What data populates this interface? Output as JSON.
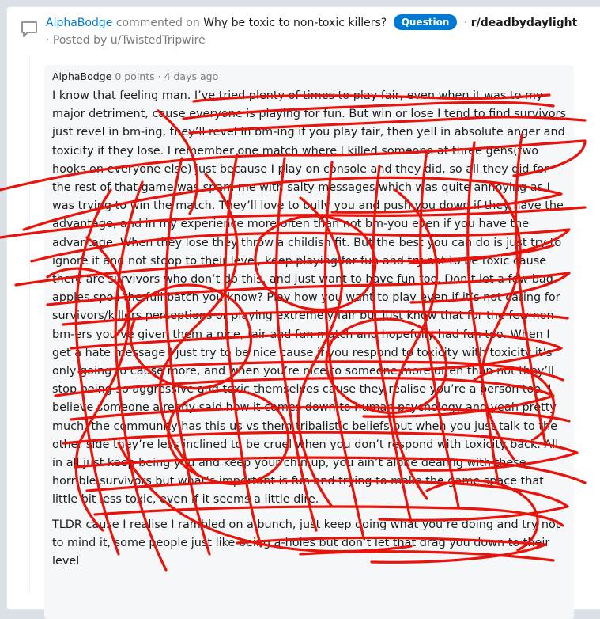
{
  "header": {
    "commenter": "AlphaBodge",
    "action_text": "commented on",
    "post_title": "Why be toxic to non-toxic killers?",
    "flair": "Question",
    "separator": "·",
    "subreddit": "r/deadbydaylight",
    "posted_by_text": "· Posted by",
    "poster": "u/TwistedTripwire"
  },
  "comment": {
    "author": "AlphaBodge",
    "points": "0 points",
    "age": "· 4 days ago",
    "paragraphs": [
      "I know that feeling man. I’ve tried plenty of times to play fair, even when it was to my major detriment, cause everyone is playing for fun. But win or lose I tend to find survivors just revel in bm-ing, they’ll revel in bm-ing if you play fair, then yell in absolute anger and toxicity if they lose. I remember one match where I killed someone at three gens(two hooks on everyone else) just because I play on console and they did, so all they did for the rest of that game was spam me with salty messages which was quite annoying as I was trying to win the match. They’ll love to bully you and push you down if they have the advantage, and in my experience more often than not bm-you even if you have the advantage. When they lose they throw a childish fit. But the best you can do is just try to ignore it and not stoop to their level, keep playing for fun and try not to be toxic cause there are survivors who don’t do this, and just want to have fun too. Don’t let a few bad apples spoil the full batch you know? Play how you want to play even if it’s not caring for survivors/killers perceptions or playing extremely fair but just know that for the few non bm-ers you’ve given them a nice, fair and fun match and hopefully had fun too. When I get a hate message I just try to be nice cause if you respond to toxicity with toxicity it’s only going to cause more, and when you’re nice to someone more often than not they’ll stop being so aggressive and toxic themselves cause they realise you’re a person too. I believe someone already said how it comes down to human psychology and yeah pretty much, the community has this us vs them tribalistic beliefs but when you just talk to the other side they’re less inclined to be cruel when you don’t respond with toxicity back. All in all just keep being you and keep your chin up, you ain’t alone dealing with these horrible survivors but what’s important is fun and trying to make the game space that little bit less toxic, even if it seems a little dire.",
      "TLDR cause I realise I rambled on a bunch, just keep doing what you’re doing and try not to mind it, some people just like being a-holes but don’t let that drag you down to their level"
    ]
  },
  "colors": {
    "background": "#dae0e6",
    "card": "#ffffff",
    "comment_box": "#f6f7f8",
    "link_blue": "#0079d3",
    "meta_gray": "#787c7e",
    "scribble_red": "#e8140c"
  },
  "icons": {
    "comment": "chat-bubble-icon"
  }
}
